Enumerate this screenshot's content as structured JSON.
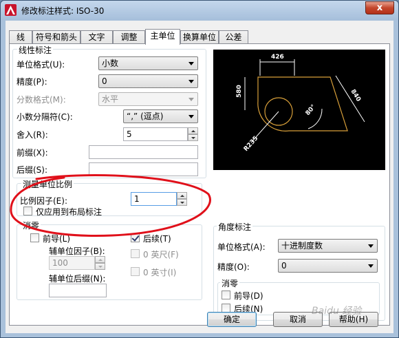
{
  "window": {
    "title": "修改标注样式: ISO-30",
    "close_label": "x"
  },
  "tabs": [
    {
      "label": "线"
    },
    {
      "label": "符号和箭头"
    },
    {
      "label": "文字"
    },
    {
      "label": "调整"
    },
    {
      "label": "主单位",
      "active": true
    },
    {
      "label": "换算单位"
    },
    {
      "label": "公差"
    }
  ],
  "linear": {
    "group_title": "线性标注",
    "unit_format_label": "单位格式(U):",
    "unit_format_value": "小数",
    "precision_label": "精度(P):",
    "precision_value": "0",
    "fraction_format_label": "分数格式(M):",
    "fraction_format_value": "水平",
    "decimal_separator_label": "小数分隔符(C):",
    "decimal_separator_value": "“,” (逗点)",
    "round_off_label": "舍入(R):",
    "round_off_value": "5",
    "prefix_label": "前缀(X):",
    "prefix_value": "",
    "suffix_label": "后缀(S):",
    "suffix_value": ""
  },
  "scale": {
    "group_title": "测量单位比例",
    "scale_factor_label": "比例因子(E):",
    "scale_factor_value": "1",
    "layout_only_label": "仅应用到布局标注",
    "layout_only_checked": false
  },
  "zero_suppression": {
    "group_title": "消零",
    "leading_label": "前导(L)",
    "leading_checked": false,
    "sub_unit_factor_label": "辅单位因子(B):",
    "sub_unit_factor_value": "100",
    "sub_unit_suffix_label": "辅单位后缀(N):",
    "sub_unit_suffix_value": "",
    "trailing_label": "后续(T)",
    "trailing_checked": true,
    "feet_label": "0 英尺(F)",
    "inches_label": "0 英寸(I)"
  },
  "angular": {
    "group_title": "角度标注",
    "unit_format_label": "单位格式(A):",
    "unit_format_value": "十进制度数",
    "precision_label": "精度(O):",
    "precision_value": "0",
    "zero_group_title": "消零",
    "leading_label": "前导(D)",
    "trailing_label": "后续(N)"
  },
  "preview": {
    "dim_top": "426",
    "dim_left": "580",
    "dim_right": "840",
    "dim_angle": "80°",
    "dim_radius": "R235"
  },
  "buttons": {
    "ok": "确定",
    "cancel": "取消",
    "help": "帮助(H)"
  },
  "watermark": "Baidu 经验",
  "colors": {
    "annotation": "#e0101a",
    "preview_bg": "#000000",
    "preview_geometry": "#d9a03a",
    "preview_dims": "#ffffff"
  }
}
